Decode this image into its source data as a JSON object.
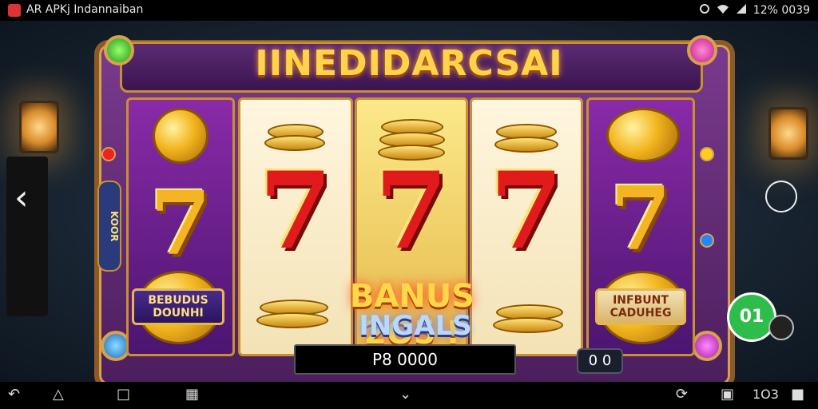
{
  "status_bar": {
    "app_title": "AR APKj  Indannaiban",
    "right_text": "12% 0039",
    "icons": [
      "notification-icon",
      "wifi-icon",
      "signal-icon"
    ]
  },
  "game": {
    "title": "IINEDIDARCSAI",
    "balance": "P8 0000",
    "counter": "0  0",
    "side_label": "KOOR",
    "chat_label": "01"
  },
  "reels": {
    "left_badge": "BEBUDUS DOUNHI",
    "right_badge": "INFBUNT CADUHEG"
  },
  "bonus": {
    "line1": "BANUS 2O5'!",
    "line2": "INGALS"
  },
  "nav_bar": {
    "right_text": "1O3",
    "icons": [
      "back-icon",
      "home-icon",
      "recents-icon",
      "screenshot-icon",
      "chevron-down-icon",
      "rotate-icon",
      "window-icon",
      "volume-icon"
    ]
  },
  "colors": {
    "accent_gold": "#ffd44a",
    "seven_red": "#e11b1b",
    "cabinet_purple": "#7a3a8e",
    "chat_green": "#2ebd4a"
  }
}
